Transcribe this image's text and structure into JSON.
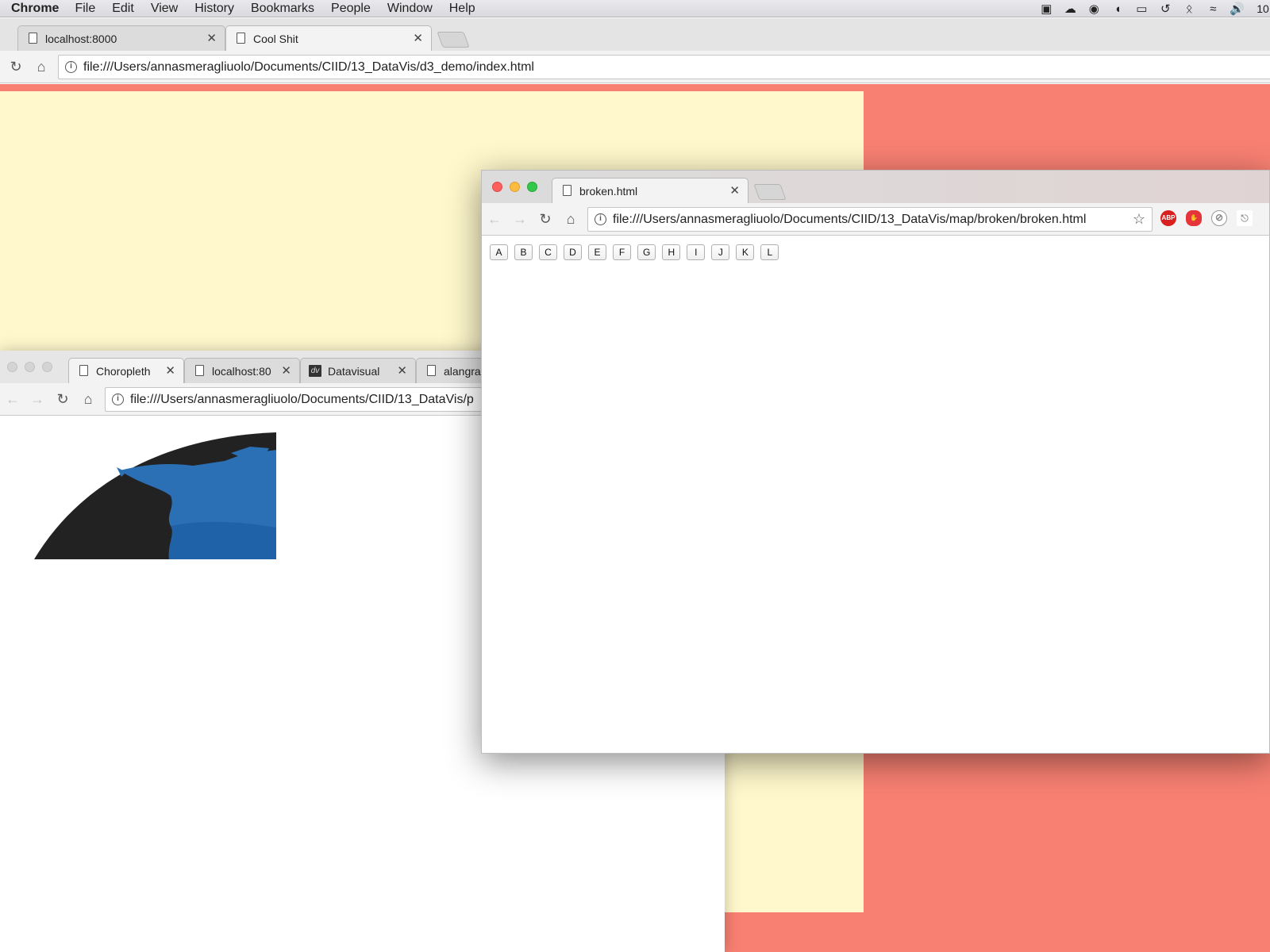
{
  "menubar": {
    "app_name": "Chrome",
    "items": [
      "File",
      "Edit",
      "View",
      "History",
      "Bookmarks",
      "People",
      "Window",
      "Help"
    ],
    "clock": "10"
  },
  "window_background": {
    "tabs": [
      {
        "label": "localhost:8000",
        "active": false
      },
      {
        "label": "Cool Shit",
        "active": true
      }
    ],
    "url": "file:///Users/annasmeragliuolo/Documents/CIID/13_DataVis/d3_demo/index.html",
    "colors": {
      "page_bg": "#f88072",
      "rect": "#fff8cc"
    }
  },
  "window_choropleth": {
    "tabs": [
      {
        "label": "Choropleth",
        "active": true
      },
      {
        "label": "localhost:80",
        "active": false
      },
      {
        "label": "Datavisual",
        "active": false,
        "favicon": "dv"
      },
      {
        "label": "alangra",
        "active": false
      }
    ],
    "url": "file:///Users/annasmeragliuolo/Documents/CIID/13_DataVis/p",
    "colors": {
      "ocean": "#222222",
      "land": "#2b6fb4"
    }
  },
  "window_front": {
    "tabs": [
      {
        "label": "broken.html",
        "active": true
      }
    ],
    "url": "file:///Users/annasmeragliuolo/Documents/CIID/13_DataVis/map/broken/broken.html",
    "letter_buttons": [
      "A",
      "B",
      "C",
      "D",
      "E",
      "F",
      "G",
      "H",
      "I",
      "J",
      "K",
      "L"
    ],
    "extensions": [
      "adblock-icon",
      "ublock-icon",
      "ghostery-icon",
      "pdf-icon"
    ],
    "extension_abp_label": "ABP"
  }
}
